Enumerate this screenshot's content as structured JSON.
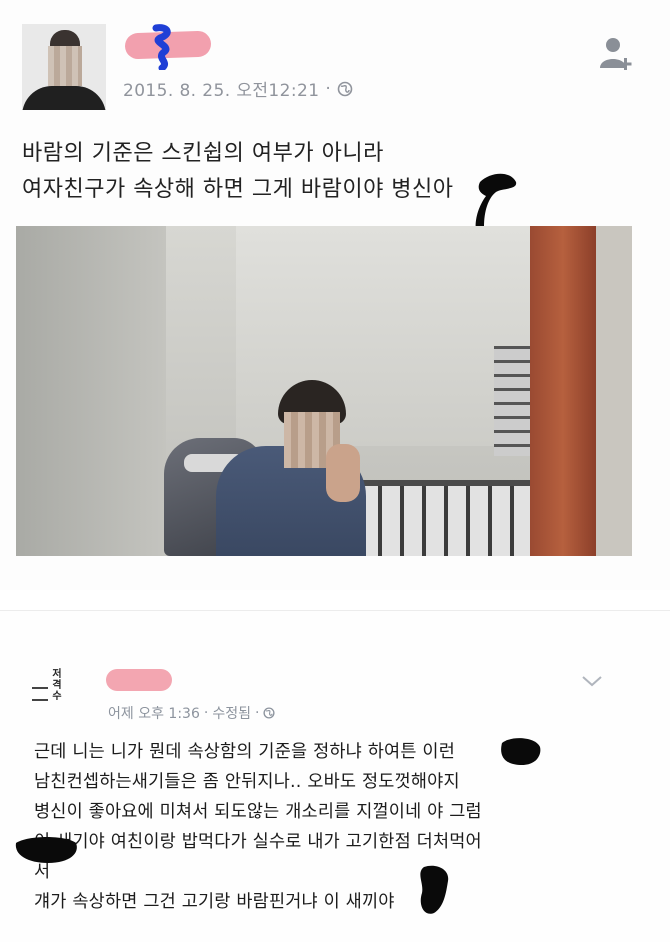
{
  "post": {
    "timestamp": "2015. 8. 25. 오전12:21",
    "separator": "·",
    "privacy_icon": "globe-icon",
    "friend_icon": "add-friend-icon",
    "text_lines": [
      "바람의 기준은 스킨쉽의 여부가 아니라",
      "여자친구가 속상해 하면 그게 바람이야 병신아"
    ]
  },
  "comment": {
    "page_logo_chars": [
      "저",
      "격",
      "수"
    ],
    "time": "어제 오후 1:36",
    "edited": "수정됨",
    "separator": "·",
    "privacy_icon": "globe-icon",
    "menu_icon": "chevron-down-icon",
    "text_lines": [
      "근데 니는 니가 뭔데 속상함의 기준을 정하냐 하여튼 이런",
      "남친컨셉하는새기들은 좀 안뒤지나.. 오바도 정도껏해야지",
      "병신이 좋아요에 미쳐서 되도않는 개소리를 지껄이네 야 그럼",
      "이 새기야 여친이랑 밥먹다가 실수로 내가 고기한점 더처먹어",
      "서",
      "걔가 속상하면 그건 고기랑 바람핀거냐 이 새끼야"
    ]
  },
  "colors": {
    "meta_gray": "#90949c",
    "redaction_pink": "#f2a0ae",
    "redaction_blue": "#1f3fd6",
    "ink": "#0a0a0a"
  }
}
